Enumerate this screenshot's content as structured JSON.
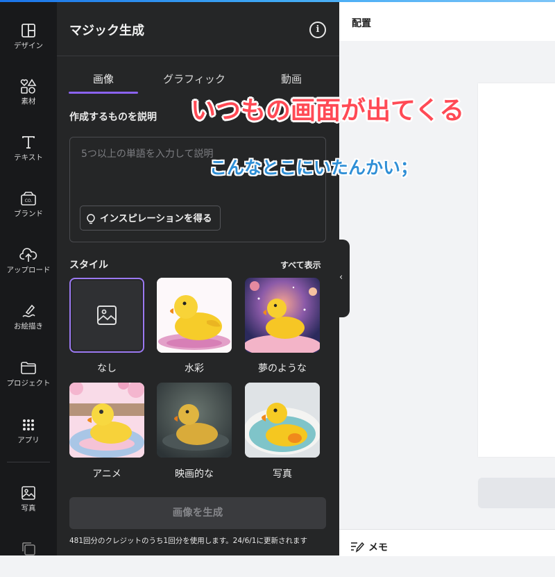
{
  "rail": {
    "items": [
      {
        "label": "デザイン",
        "icon": "layout-icon"
      },
      {
        "label": "素材",
        "icon": "shapes-icon"
      },
      {
        "label": "テキスト",
        "icon": "text-icon"
      },
      {
        "label": "ブランド",
        "icon": "brand-icon"
      },
      {
        "label": "アップロード",
        "icon": "upload-cloud-icon"
      },
      {
        "label": "お絵描き",
        "icon": "draw-icon"
      },
      {
        "label": "プロジェクト",
        "icon": "folder-icon"
      },
      {
        "label": "アプリ",
        "icon": "apps-grid-icon"
      },
      {
        "label": "写真",
        "icon": "photo-icon"
      }
    ]
  },
  "panel": {
    "title": "マジック生成",
    "tabs": [
      "画像",
      "グラフィック",
      "動画"
    ],
    "active_tab": "画像",
    "describe_label": "作成するものを説明",
    "prompt_placeholder": "5つ以上の単語を入力して説明",
    "inspiration_label": "インスピレーションを得る",
    "style_label": "スタイル",
    "show_all": "すべて表示",
    "styles": [
      "なし",
      "水彩",
      "夢のような",
      "アニメ",
      "映画的な",
      "写真"
    ],
    "selected_style": "なし",
    "generate_label": "画像を生成",
    "credits_text": "481回分のクレジットのうち1回分を使用します。24/6/1に更新されます"
  },
  "topbar": {
    "title": "配置"
  },
  "footer": {
    "memo_label": "メモ"
  },
  "captions": {
    "main": "いつもの画面が出てくる",
    "sub": "こんなとこにいたんかい；"
  },
  "colors": {
    "accent": "#8b63f0",
    "caption_red": "#ff4a55",
    "caption_blue": "#2f8fd6",
    "rail_bg": "#18191b",
    "panel_bg": "#252627"
  }
}
